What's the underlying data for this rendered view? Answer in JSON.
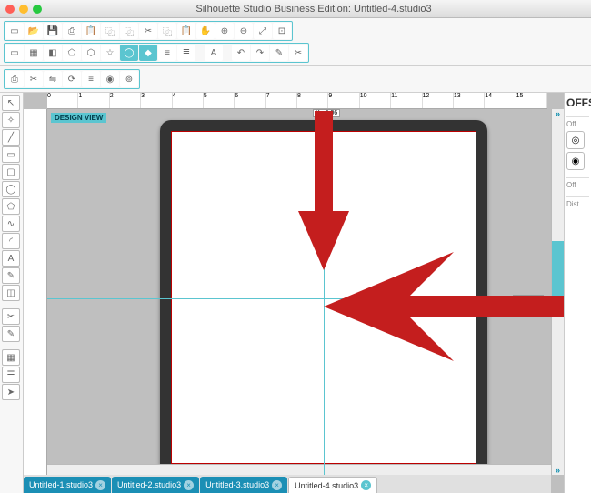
{
  "titlebar": {
    "title": "Silhouette Studio Business Edition: Untitled-4.studio3"
  },
  "traffic": {
    "close": "#ff5f57",
    "min": "#ffbd2e",
    "max": "#28c940"
  },
  "coord": "6.062 , 5.665",
  "design_view": "DESIGN VIEW",
  "ptr_x": "X : 6.06",
  "ptr_y": "Y : 5.250",
  "ruler_labels": [
    "0",
    "1",
    "2",
    "3",
    "4",
    "5",
    "6",
    "7",
    "8",
    "9",
    "10",
    "11",
    "12",
    "13",
    "14",
    "15"
  ],
  "tabs": [
    {
      "label": "Untitled-1.studio3",
      "active": false
    },
    {
      "label": "Untitled-2.studio3",
      "active": false
    },
    {
      "label": "Untitled-3.studio3",
      "active": false
    },
    {
      "label": "Untitled-4.studio3",
      "active": true
    }
  ],
  "panel": {
    "heading": "OFFS",
    "sec1": "Off",
    "sec2": "Off",
    "dist": "Dist"
  },
  "left_tools": [
    "select",
    "edit",
    "line",
    "rect",
    "rrect",
    "oval",
    "poly",
    "curve",
    "arc",
    "text",
    "draw",
    "eraser",
    "",
    "knife",
    "note",
    "",
    "swatch",
    "layers",
    "send"
  ],
  "top1": [
    "new",
    "open",
    "save",
    "save2",
    "paste",
    "copy",
    "dup",
    "",
    "cut",
    "copy2",
    "paste2",
    "",
    "hand",
    "zoomin",
    "zoomout",
    "zoomfit",
    "zoom3"
  ],
  "top2": [
    "page",
    "grid",
    "fill",
    "shape1",
    "shape2",
    "shape3",
    "shape4",
    "shape5",
    "line1",
    "line2",
    "",
    "text",
    "",
    "undo",
    "redo",
    "trace",
    "knife2"
  ],
  "top3": [
    "print",
    "cut",
    "mirror",
    "rotate",
    "align",
    "weld",
    "target"
  ]
}
